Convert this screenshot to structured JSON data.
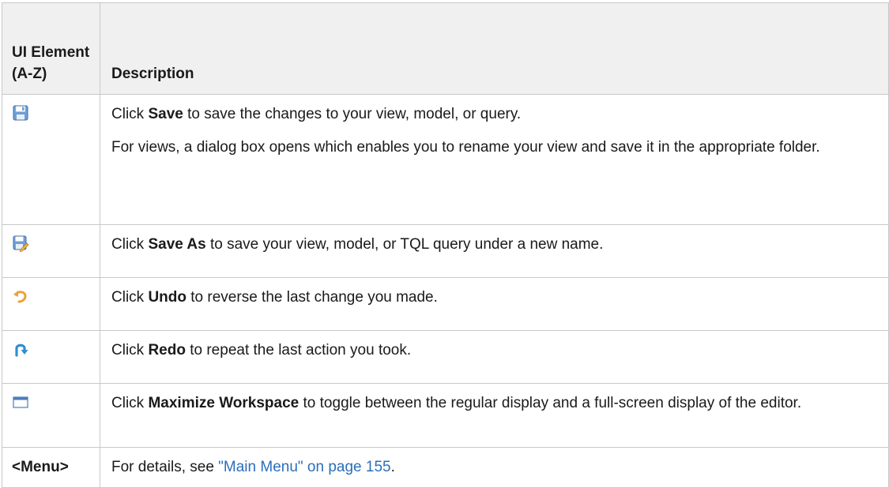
{
  "header": {
    "col1": "UI Element (A-Z)",
    "col2": "Description"
  },
  "rows": [
    {
      "icon": "save-icon",
      "lines": [
        {
          "pre": "Click ",
          "bold": "Save",
          "post": " to save the changes to your view, model, or query."
        },
        {
          "text": "For views, a dialog box opens which enables you to rename your view and save it in the appropriate folder."
        }
      ]
    },
    {
      "icon": "save-as-icon",
      "pre": "Click ",
      "bold": "Save As",
      "post": " to save your view, model, or TQL query under a new name."
    },
    {
      "icon": "undo-icon",
      "pre": "Click ",
      "bold": "Undo",
      "post": " to reverse the last change you made."
    },
    {
      "icon": "redo-icon",
      "pre": "Click ",
      "bold": "Redo",
      "post": " to repeat the last action you took."
    },
    {
      "icon": "maximize-workspace-icon",
      "pre": "Click ",
      "bold": "Maximize Workspace",
      "post": " to toggle between the regular display and a full-screen display of the editor."
    },
    {
      "element": "<Menu>",
      "pre": "For details, see ",
      "link": "\"Main Menu\" on page 155",
      "post": "."
    }
  ]
}
